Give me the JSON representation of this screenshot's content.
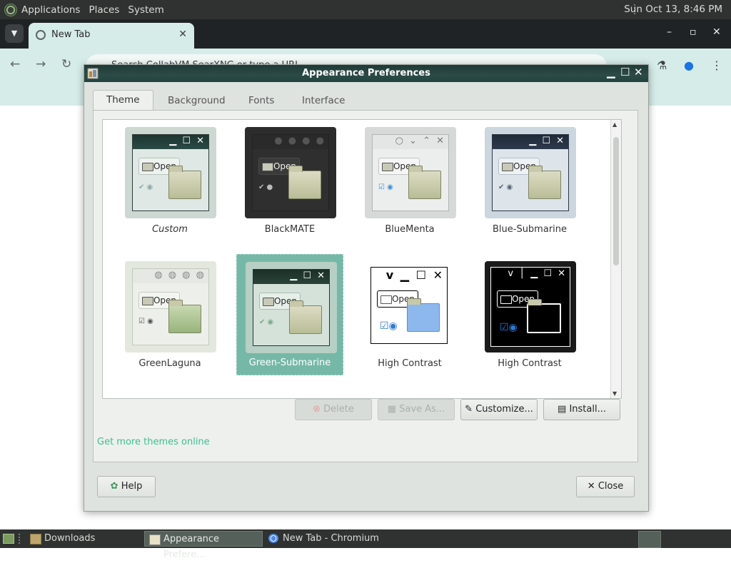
{
  "top_panel": {
    "menus": [
      "Applications",
      "Places",
      "System"
    ],
    "clock": "Sun Oct 13,  8:46 PM"
  },
  "browser": {
    "tab_title": "New Tab",
    "tab_close": "✕",
    "omnibox_placeholder": "Search CollabVM SearXNG or type a URL",
    "window_controls": [
      "–",
      "▫",
      "✕"
    ]
  },
  "dialog": {
    "title": "Appearance Preferences",
    "tabs": [
      "Theme",
      "Background",
      "Fonts",
      "Interface"
    ],
    "active_tab": "Theme",
    "themes": [
      {
        "name": "Custom",
        "italic": true,
        "selected": false,
        "style": "custom"
      },
      {
        "name": "BlackMATE",
        "italic": false,
        "selected": false,
        "style": "blackmate"
      },
      {
        "name": "BlueMenta",
        "italic": false,
        "selected": false,
        "style": "bluementa"
      },
      {
        "name": "Blue-Submarine",
        "italic": false,
        "selected": false,
        "style": "bluesub"
      },
      {
        "name": "GreenLaguna",
        "italic": false,
        "selected": false,
        "style": "greenlaguna"
      },
      {
        "name": "Green-Submarine",
        "italic": false,
        "selected": true,
        "style": "greensub"
      },
      {
        "name": "High Contrast",
        "italic": false,
        "selected": false,
        "style": "hc"
      },
      {
        "name": "High Contrast",
        "italic": false,
        "selected": false,
        "style": "hci"
      }
    ],
    "thumbnail_open_label": "Open",
    "buttons": {
      "delete": "Delete",
      "save_as": "Save As...",
      "customize": "Customize...",
      "install": "Install..."
    },
    "link": "Get more themes online",
    "help": "Help",
    "close": "Close"
  },
  "taskbar": {
    "items": [
      {
        "label": "Downloads",
        "active": false
      },
      {
        "label": "Appearance Prefere...",
        "active": true
      },
      {
        "label": "New Tab - Chromium",
        "active": false
      }
    ]
  },
  "colors": {
    "selection": "#76b8a8",
    "link": "#3cbf92",
    "titlebar": "#2c4b47"
  }
}
